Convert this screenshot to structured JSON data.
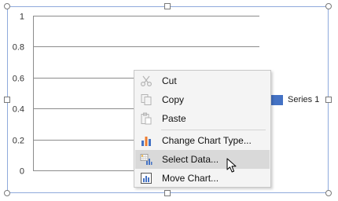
{
  "chart_data": {
    "type": "bar",
    "categories": [],
    "series": [
      {
        "name": "Series 1",
        "values": []
      }
    ],
    "yticks": [
      "1",
      "0.8",
      "0.6",
      "0.4",
      "0.2",
      "0"
    ],
    "ylim": [
      0,
      1
    ],
    "legend_position": "right",
    "series_color": "#4472c4"
  },
  "legend": {
    "label": "Series 1"
  },
  "context_menu": {
    "items": [
      {
        "label": "Cut",
        "icon": "scissors-icon",
        "disabled": true
      },
      {
        "label": "Copy",
        "icon": "copy-icon",
        "disabled": true
      },
      {
        "label": "Paste",
        "icon": "paste-icon",
        "disabled": true
      },
      {
        "label": "Change Chart Type...",
        "icon": "bar-chart-icon",
        "disabled": false
      },
      {
        "label": "Select Data...",
        "icon": "select-data-icon",
        "disabled": false,
        "hovered": true
      },
      {
        "label": "Move Chart...",
        "icon": "move-chart-icon",
        "disabled": false
      }
    ]
  },
  "colors": {
    "frame_border": "#8faadc",
    "hover_bg": "#d9d9d9",
    "menu_bg": "#f4f4f4"
  }
}
